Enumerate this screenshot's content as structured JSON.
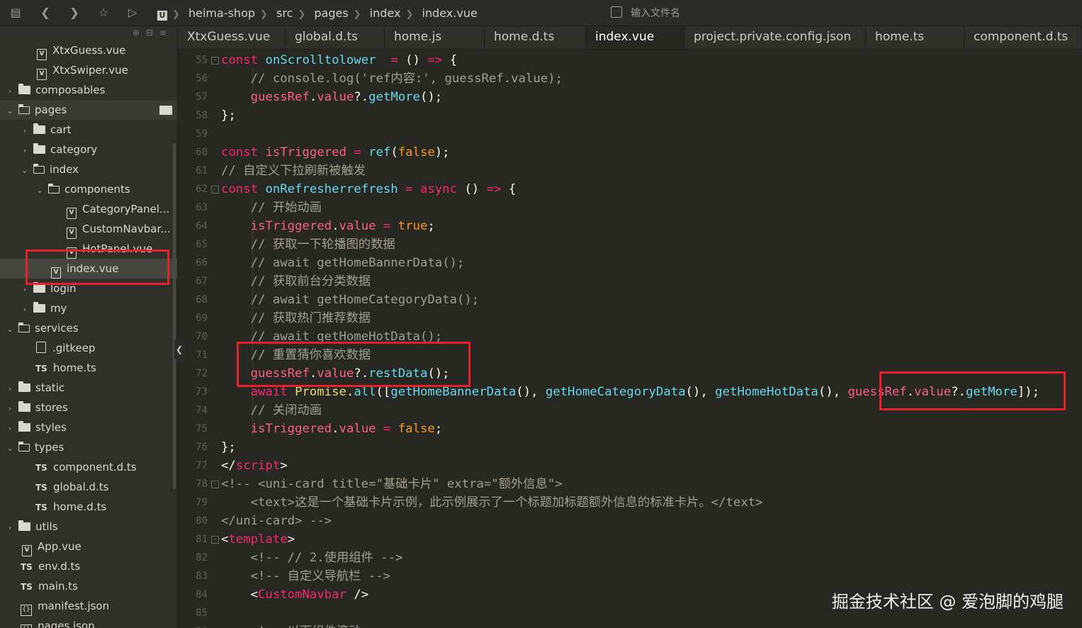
{
  "breadcrumb": [
    "heima-shop",
    "src",
    "pages",
    "index",
    "index.vue"
  ],
  "project_icon_label": "U",
  "file_search_placeholder": "输入文件名",
  "tabs": [
    {
      "label": "XtxGuess.vue"
    },
    {
      "label": "global.d.ts"
    },
    {
      "label": "home.js"
    },
    {
      "label": "home.d.ts"
    },
    {
      "label": "index.vue",
      "active": true
    },
    {
      "label": "project.private.config.json"
    },
    {
      "label": "home.ts"
    },
    {
      "label": "component.d.ts"
    }
  ],
  "tree": [
    {
      "label": "XtxGuess.vue",
      "type": "vue",
      "depth": 2
    },
    {
      "label": "XtxSwiper.vue",
      "type": "vue",
      "depth": 2
    },
    {
      "label": "composables",
      "type": "folder",
      "depth": 0,
      "expanded": false
    },
    {
      "label": "pages",
      "type": "folder",
      "depth": 0,
      "expanded": true,
      "hover": true
    },
    {
      "label": "cart",
      "type": "folder",
      "depth": 1,
      "expanded": false
    },
    {
      "label": "category",
      "type": "folder",
      "depth": 1,
      "expanded": false
    },
    {
      "label": "index",
      "type": "folder",
      "depth": 1,
      "expanded": true
    },
    {
      "label": "components",
      "type": "folder",
      "depth": 2,
      "expanded": true
    },
    {
      "label": "CategoryPanel...",
      "type": "vue",
      "depth": 4
    },
    {
      "label": "CustomNavbar...",
      "type": "vue",
      "depth": 4
    },
    {
      "label": "HotPanel.vue",
      "type": "vue",
      "depth": 4
    },
    {
      "label": "index.vue",
      "type": "vue",
      "depth": 3,
      "selected": true
    },
    {
      "label": "login",
      "type": "folder",
      "depth": 1,
      "expanded": false
    },
    {
      "label": "my",
      "type": "folder",
      "depth": 1,
      "expanded": false
    },
    {
      "label": "services",
      "type": "folder",
      "depth": 0,
      "expanded": true
    },
    {
      "label": ".gitkeep",
      "type": "file",
      "depth": 2
    },
    {
      "label": "home.ts",
      "type": "ts",
      "depth": 2
    },
    {
      "label": "static",
      "type": "folder",
      "depth": 0,
      "expanded": false
    },
    {
      "label": "stores",
      "type": "folder",
      "depth": 0,
      "expanded": false
    },
    {
      "label": "styles",
      "type": "folder",
      "depth": 0,
      "expanded": false
    },
    {
      "label": "types",
      "type": "folder",
      "depth": 0,
      "expanded": true
    },
    {
      "label": "component.d.ts",
      "type": "ts",
      "depth": 2
    },
    {
      "label": "global.d.ts",
      "type": "ts",
      "depth": 2
    },
    {
      "label": "home.d.ts",
      "type": "ts",
      "depth": 2
    },
    {
      "label": "utils",
      "type": "folder",
      "depth": 0,
      "expanded": false
    },
    {
      "label": "App.vue",
      "type": "vue",
      "depth": 1
    },
    {
      "label": "env.d.ts",
      "type": "ts",
      "depth": 1
    },
    {
      "label": "main.ts",
      "type": "ts",
      "depth": 1
    },
    {
      "label": "manifest.json",
      "type": "json",
      "depth": 1
    },
    {
      "label": "pages.json",
      "type": "json",
      "depth": 1
    }
  ],
  "code_lines": [
    {
      "n": 55,
      "fold": true,
      "tokens": [
        [
          "k",
          "const "
        ],
        [
          "fn",
          "onScrolltolower"
        ],
        [
          "",
          "  "
        ],
        [
          "k",
          "="
        ],
        [
          "",
          " () "
        ],
        [
          "k",
          "=>"
        ],
        [
          "",
          " {"
        ]
      ]
    },
    {
      "n": 56,
      "tokens": [
        [
          "c",
          "    // console.log('ref内容:', guessRef.value);"
        ]
      ]
    },
    {
      "n": 57,
      "tokens": [
        [
          "",
          "    "
        ],
        [
          "v",
          "guessRef"
        ],
        [
          "",
          "."
        ],
        [
          "v",
          "value"
        ],
        [
          "",
          "?."
        ],
        [
          "fn",
          "getMore"
        ],
        [
          "",
          "();"
        ]
      ]
    },
    {
      "n": 58,
      "tokens": [
        [
          "",
          "};"
        ]
      ]
    },
    {
      "n": 59,
      "tokens": []
    },
    {
      "n": 60,
      "tokens": [
        [
          "k",
          "const "
        ],
        [
          "v",
          "isTriggered"
        ],
        [
          "",
          " "
        ],
        [
          "k",
          "="
        ],
        [
          "",
          " "
        ],
        [
          "fn",
          "ref"
        ],
        [
          "",
          "("
        ],
        [
          "n",
          "false"
        ],
        [
          "",
          ");"
        ]
      ]
    },
    {
      "n": 61,
      "tokens": [
        [
          "c",
          "// 自定义下拉刷新被触发"
        ]
      ]
    },
    {
      "n": 62,
      "fold": true,
      "tokens": [
        [
          "k",
          "const "
        ],
        [
          "fn",
          "onRefresherrefresh"
        ],
        [
          "",
          " "
        ],
        [
          "k",
          "="
        ],
        [
          "",
          " "
        ],
        [
          "k",
          "async"
        ],
        [
          "",
          " () "
        ],
        [
          "k",
          "=>"
        ],
        [
          "",
          " {"
        ]
      ]
    },
    {
      "n": 63,
      "tokens": [
        [
          "c",
          "    // 开始动画"
        ]
      ]
    },
    {
      "n": 64,
      "tokens": [
        [
          "",
          "    "
        ],
        [
          "v",
          "isTriggered"
        ],
        [
          "",
          "."
        ],
        [
          "v",
          "value"
        ],
        [
          "",
          " "
        ],
        [
          "k",
          "="
        ],
        [
          "",
          " "
        ],
        [
          "n",
          "true"
        ],
        [
          "",
          ";"
        ]
      ]
    },
    {
      "n": 65,
      "tokens": [
        [
          "c",
          "    // 获取一下轮播图的数据"
        ]
      ]
    },
    {
      "n": 66,
      "tokens": [
        [
          "c",
          "    // await getHomeBannerData();"
        ]
      ]
    },
    {
      "n": 67,
      "tokens": [
        [
          "c",
          "    // 获取前台分类数据"
        ]
      ]
    },
    {
      "n": 68,
      "tokens": [
        [
          "c",
          "    // await getHomeCategoryData();"
        ]
      ]
    },
    {
      "n": 69,
      "tokens": [
        [
          "c",
          "    // 获取热门推荐数据"
        ]
      ]
    },
    {
      "n": 70,
      "tokens": [
        [
          "c",
          "    // await getHomeHotData();"
        ]
      ]
    },
    {
      "n": 71,
      "tokens": [
        [
          "c",
          "    // 重置猜你喜欢数据"
        ]
      ]
    },
    {
      "n": 72,
      "tokens": [
        [
          "",
          "    "
        ],
        [
          "v",
          "guessRef"
        ],
        [
          "",
          "."
        ],
        [
          "v",
          "value"
        ],
        [
          "",
          "?."
        ],
        [
          "fn",
          "restData"
        ],
        [
          "",
          "();"
        ]
      ]
    },
    {
      "n": 73,
      "tokens": [
        [
          "",
          "    "
        ],
        [
          "k",
          "await "
        ],
        [
          "cls",
          "Promise"
        ],
        [
          "",
          "."
        ],
        [
          "fn",
          "all"
        ],
        [
          "",
          "(["
        ],
        [
          "fn",
          "getHomeBannerData"
        ],
        [
          "",
          "(), "
        ],
        [
          "fn",
          "getHomeCategoryData"
        ],
        [
          "",
          "(), "
        ],
        [
          "fn",
          "getHomeHotData"
        ],
        [
          "",
          "(), "
        ],
        [
          "v",
          "guessRef"
        ],
        [
          "",
          "."
        ],
        [
          "v",
          "value"
        ],
        [
          "",
          "?."
        ],
        [
          "fn",
          "getMore"
        ],
        [
          "",
          "]);"
        ]
      ]
    },
    {
      "n": 74,
      "tokens": [
        [
          "c",
          "    // 关闭动画"
        ]
      ]
    },
    {
      "n": 75,
      "tokens": [
        [
          "",
          "    "
        ],
        [
          "v",
          "isTriggered"
        ],
        [
          "",
          "."
        ],
        [
          "v",
          "value"
        ],
        [
          "",
          " "
        ],
        [
          "k",
          "="
        ],
        [
          "",
          " "
        ],
        [
          "n",
          "false"
        ],
        [
          "",
          ";"
        ]
      ]
    },
    {
      "n": 76,
      "tokens": [
        [
          "",
          "};"
        ]
      ]
    },
    {
      "n": 77,
      "tokens": [
        [
          "",
          "</"
        ],
        [
          "tag",
          "script"
        ],
        [
          "",
          ">"
        ]
      ]
    },
    {
      "n": 78,
      "fold": true,
      "tokens": [
        [
          "c",
          "<!-- <uni-card title=\"基础卡片\" extra=\"额外信息\">"
        ]
      ]
    },
    {
      "n": 79,
      "tokens": [
        [
          "c",
          "    <text>这是一个基础卡片示例，此示例展示了一个标题加标题额外信息的标准卡片。</text>"
        ]
      ]
    },
    {
      "n": 80,
      "tokens": [
        [
          "c",
          "</uni-card> -->"
        ]
      ]
    },
    {
      "n": 81,
      "fold": true,
      "tokens": [
        [
          "",
          "<"
        ],
        [
          "tag",
          "template"
        ],
        [
          "",
          ">"
        ]
      ]
    },
    {
      "n": 82,
      "tokens": [
        [
          "c",
          "    <!-- // 2.使用组件 -->"
        ]
      ]
    },
    {
      "n": 83,
      "tokens": [
        [
          "c",
          "    <!-- 自定义导航栏 -->"
        ]
      ]
    },
    {
      "n": 84,
      "tokens": [
        [
          "",
          "    <"
        ],
        [
          "tag",
          "CustomNavbar"
        ],
        [
          "",
          " />"
        ]
      ]
    },
    {
      "n": 85,
      "tokens": []
    },
    {
      "n": 86,
      "tokens": [
        [
          "c",
          "    <!-- 以下组件滚动"
        ]
      ]
    }
  ],
  "watermark": "掘金技术社区 @ 爱泡脚的鸡腿",
  "highlight_color": "#e8212c"
}
